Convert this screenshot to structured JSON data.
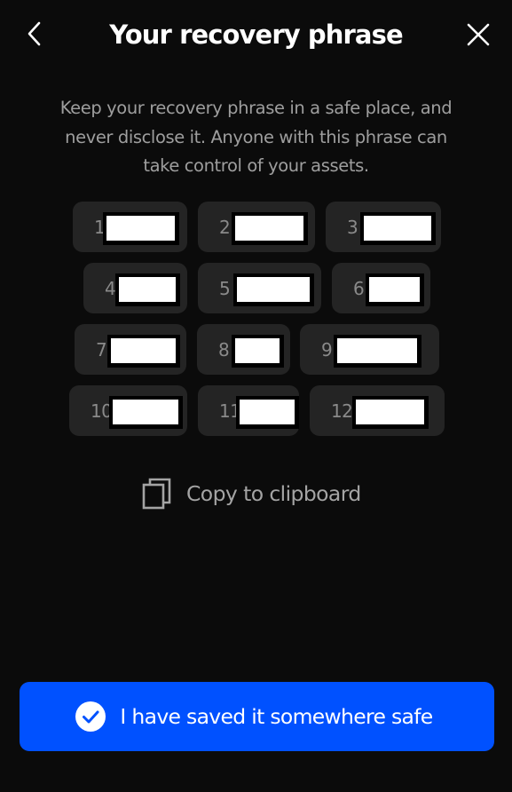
{
  "header": {
    "title": "Your recovery phrase",
    "back_icon": "chevron-left-icon",
    "close_icon": "close-icon"
  },
  "description": "Keep your recovery phrase in a safe place, and never disclose it. Anyone with this phrase can take control of your assets.",
  "words": [
    {
      "index": "1",
      "word": ""
    },
    {
      "index": "2",
      "word": ""
    },
    {
      "index": "3",
      "word": ""
    },
    {
      "index": "4",
      "word": ""
    },
    {
      "index": "5",
      "word": ""
    },
    {
      "index": "6",
      "word": ""
    },
    {
      "index": "7",
      "word": ""
    },
    {
      "index": "8",
      "word": ""
    },
    {
      "index": "9",
      "word": ""
    },
    {
      "index": "10",
      "word": ""
    },
    {
      "index": "11",
      "word": ""
    },
    {
      "index": "12",
      "word": ""
    }
  ],
  "copy_action": {
    "label": "Copy to clipboard",
    "icon": "copy-icon"
  },
  "confirm_action": {
    "label": "I have saved it somewhere safe",
    "icon": "check-circle-icon"
  },
  "colors": {
    "background": "#0b0b0b",
    "chip": "#242424",
    "accent": "#0051ff",
    "muted_text": "#9e9e9e"
  }
}
